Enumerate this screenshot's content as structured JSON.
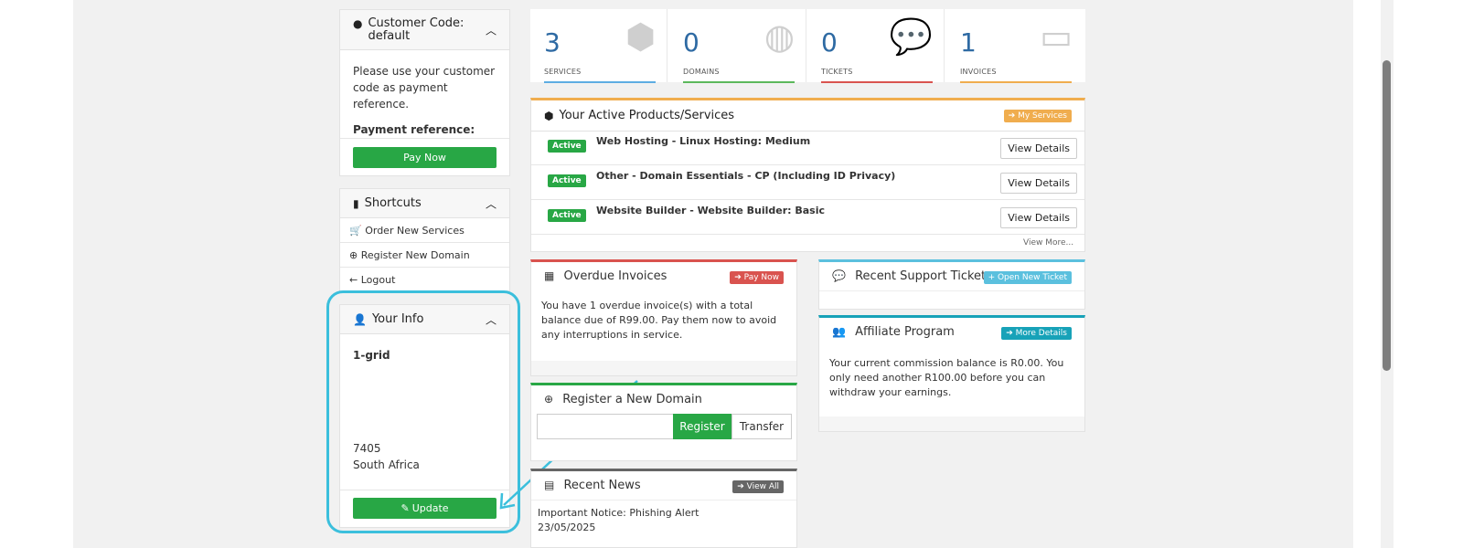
{
  "customer_code": {
    "title": "Customer Code: default",
    "message": "Please use your customer code as payment reference.",
    "payment_ref_label": "Payment reference:",
    "pay_now": "Pay Now"
  },
  "shortcuts": {
    "title": "Shortcuts",
    "items": [
      {
        "label": "Order New Services"
      },
      {
        "label": "Register New Domain"
      },
      {
        "label": "Logout"
      }
    ]
  },
  "your_info": {
    "title": "Your Info",
    "company": "1-grid",
    "postal_code": "7405",
    "country": "South Africa",
    "update": "Update"
  },
  "stats": [
    {
      "value": "3",
      "label": "SERVICES",
      "color": "#5dade2"
    },
    {
      "value": "0",
      "label": "DOMAINS",
      "color": "#5cb85c"
    },
    {
      "value": "0",
      "label": "TICKETS",
      "color": "#d9534f"
    },
    {
      "value": "1",
      "label": "INVOICES",
      "color": "#f0ad4e"
    }
  ],
  "active_products": {
    "title": "Your Active Products/Services",
    "button": "My Services",
    "view_more": "View More...",
    "items": [
      {
        "status": "Active",
        "name": "Web Hosting - Linux Hosting: Medium",
        "action": "View Details"
      },
      {
        "status": "Active",
        "name": "Other - Domain Essentials - CP (Including ID Privacy)",
        "action": "View Details"
      },
      {
        "status": "Active",
        "name": "Website Builder - Website Builder: Basic",
        "action": "View Details"
      }
    ]
  },
  "overdue": {
    "title": "Overdue Invoices",
    "button": "Pay Now",
    "text": "You have 1 overdue invoice(s) with a total balance due of R99.00. Pay them now to avoid any interruptions in service."
  },
  "support": {
    "title": "Recent Support Tickets",
    "button": "Open New Ticket"
  },
  "affiliate": {
    "title": "Affiliate Program",
    "button": "More Details",
    "text": "Your current commission balance is R0.00. You only need another R100.00 before you can withdraw your earnings."
  },
  "register_domain": {
    "title": "Register a New Domain",
    "register": "Register",
    "transfer": "Transfer",
    "input_value": ""
  },
  "news": {
    "title": "Recent News",
    "button": "View All",
    "item_title": "Important Notice: Phishing Alert",
    "item_date": "23/05/2025"
  },
  "colors": {
    "green": "#28a745",
    "orange": "#f0ad4e",
    "red": "#d9534f",
    "blue": "#5bc0de",
    "teal": "#17a2b8",
    "highlight": "#3bbfdc"
  }
}
